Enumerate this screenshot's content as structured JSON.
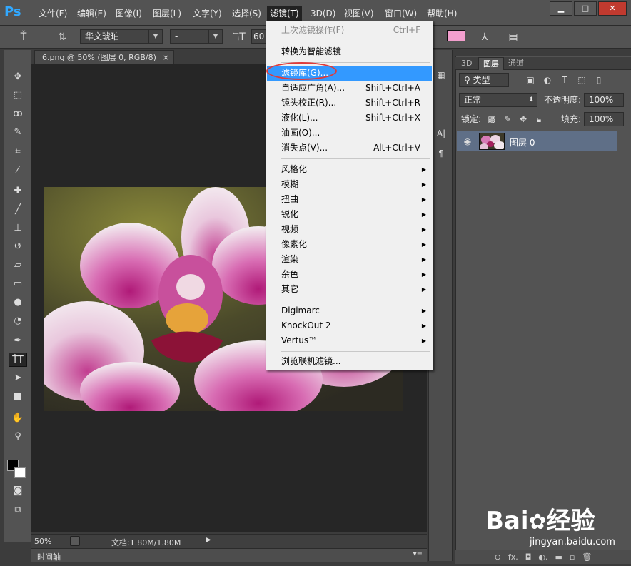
{
  "app": {
    "logo": "Ps"
  },
  "menubar": {
    "items": [
      "文件(F)",
      "编辑(E)",
      "图像(I)",
      "图层(L)",
      "文字(Y)",
      "选择(S)",
      "滤镜(T)",
      "3D(D)",
      "视图(V)",
      "窗口(W)",
      "帮助(H)"
    ]
  },
  "options": {
    "font_family": "华文琥珀",
    "font_style": "-",
    "font_size": "60",
    "text_color": "#f39fce"
  },
  "document": {
    "tab_title": "6.png @ 50% (图层 0, RGB/8)",
    "tab_close": "×",
    "zoom": "50%",
    "doc_info": "文档:1.80M/1.80M",
    "timeline_label": "时间轴"
  },
  "filter_menu": {
    "last_filter": {
      "label": "上次滤镜操作(F)",
      "shortcut": "Ctrl+F"
    },
    "smart": "转换为智能滤镜",
    "group1": [
      {
        "label": "滤镜库(G)...",
        "shortcut": ""
      },
      {
        "label": "自适应广角(A)...",
        "shortcut": "Shift+Ctrl+A"
      },
      {
        "label": "镜头校正(R)...",
        "shortcut": "Shift+Ctrl+R"
      },
      {
        "label": "液化(L)...",
        "shortcut": "Shift+Ctrl+X"
      },
      {
        "label": "油画(O)...",
        "shortcut": ""
      },
      {
        "label": "消失点(V)...",
        "shortcut": "Alt+Ctrl+V"
      }
    ],
    "group2": [
      "风格化",
      "模糊",
      "扭曲",
      "锐化",
      "视频",
      "像素化",
      "渲染",
      "杂色",
      "其它"
    ],
    "group3": [
      "Digimarc",
      "KnockOut 2",
      "Vertus™"
    ],
    "browse": "浏览联机滤镜..."
  },
  "layers_panel": {
    "tabs": [
      "3D",
      "图层",
      "通道"
    ],
    "kind_filter": "类型",
    "blend_mode": "正常",
    "opacity_label": "不透明度:",
    "opacity": "100%",
    "lock_label": "锁定:",
    "fill_label": "填充:",
    "fill": "100%",
    "layer_name": "图层 0"
  },
  "watermark": {
    "brand": "Bai",
    "brand2": "经验",
    "url": "jingyan.baidu.com"
  }
}
